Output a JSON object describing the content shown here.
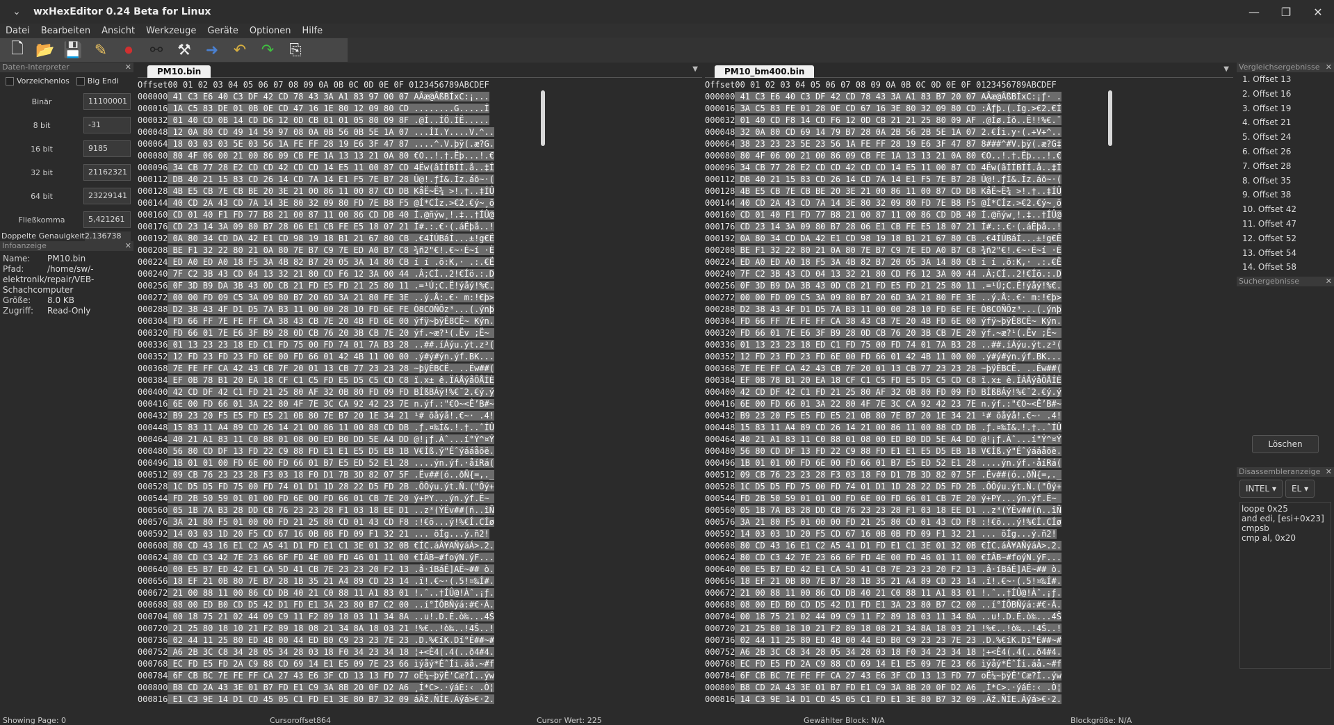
{
  "window": {
    "title": "wxHexEditor 0.24 Beta for Linux"
  },
  "menu": [
    "Datei",
    "Bearbeiten",
    "Ansicht",
    "Werkzeuge",
    "Geräte",
    "Optionen",
    "Hilfe"
  ],
  "data_interpreter": {
    "title": "Daten-Interpreter",
    "signed_label": "Vorzeichenlos",
    "big_endian_label": "Big Endi",
    "rows": [
      {
        "label": "Binär",
        "value": "11100001"
      },
      {
        "label": "8 bit",
        "value": "-31"
      },
      {
        "label": "16 bit",
        "value": "9185"
      },
      {
        "label": "32 bit",
        "value": "21162321"
      },
      {
        "label": "64 bit",
        "value": "23229141"
      },
      {
        "label": "Fließkomma",
        "value": "5,421261"
      }
    ],
    "double_label": "Doppelte Genauigkeit",
    "double_value": "2.136738"
  },
  "info": {
    "title": "Infoanzeige",
    "name_k": "Name:",
    "name_v": "PM10.bin",
    "path_k": "Pfad:",
    "path_v": "/home/sw/-",
    "path_v2": "elektronik/repair/VEB-",
    "path_v3": "Schachcomputer",
    "size_k": "Größe:",
    "size_v": "8.0 KB",
    "access_k": "Zugriff:",
    "access_v": "Read-Only"
  },
  "header_line": "Offset00 01 02 03 04 05 06 07 08 09 0A 0B 0C 0D 0E 0F 0123456789ABCDEF",
  "left_editor": {
    "tab": "PM10.bin",
    "lines": [
      [
        "000000",
        "41 C3 E6 40 C3 DF 42 CD 78 43 3A A1 83 97 00 07",
        "AÃæ@ÃßBÍxC:¡..."
      ],
      [
        "000016",
        "1A C5 83 DE 01 0B 0E CD 47 16 1E 80 12 09 80 CD",
        "........G.....Í"
      ],
      [
        "000032",
        "01 40 CD 0B 14 CD D6 12 0D CB 01 01 05 80 09 8F",
        ".@Í..ÍÖ.ÍË....."
      ],
      [
        "000048",
        "12 0A 80 CD 49 14 59 97 08 0A 0B 56 0B 5E 1A 07",
        "...ÍI.Y....V.^.."
      ],
      [
        "000064",
        "18 03 03 03 5E 03 56 1A FE FF 28 19 E6 3F 47 87",
        "....^.V.þÿ(.æ?G."
      ],
      [
        "000080",
        "80 4F 06 00 21 00 86 09 CB FE 1A 13 13 21 0A 80",
        "€O..!.†.Ëþ...!.€"
      ],
      [
        "000096",
        "34 CB 77 28 E2 CD CD 42 CD CD 14 E5 11 00 87 CD",
        "4Ëw(âÍÍBÍÍ.å..‡Í"
      ],
      [
        "000112",
        "DB 40 21 15 83 CD 26 14 CD 7A 14 E1 F5 7E B7 28",
        "Û@!.ƒÍ&.Íz.áõ~·("
      ],
      [
        "000128",
        "4B E5 CB 7E CB BE 20 3E 21 00 86 11 00 87 CD DB",
        "KåË~Ë¾ >!.†..‡ÍÛ"
      ],
      [
        "000144",
        "40 CD 2A 43 CD 7A 14 3E 80 32 09 80 FD 7E B8 F5",
        "@Í*CÍz.>€2.€ý~¸õ"
      ],
      [
        "000160",
        "CD 01 40 F1 FD 77 B8 21 00 87 11 00 86 CD DB 40",
        "Í.@ñýw¸!.‡..†ÍÛ@"
      ],
      [
        "000176",
        "CD 23 14 3A 09 80 B7 28 06 E1 CB FE E5 18 07 21",
        "Í#.:.€·(.áËþå..!"
      ],
      [
        "000192",
        "0A 80 34 CD DA 42 E1 CD 98 19 18 B1 21 67 80 CB",
        ".€4ÍÚBáÍ...±!g€Ë"
      ],
      [
        "000208",
        "BE F1 32 22 80 21 0A 80 7E B7 C9 7E ED A0 B7 C8",
        "¾ñ2\"€!.€~·É~í ·È"
      ],
      [
        "000224",
        "ED A0 ED A0 18 F5 3A 4B 82 B7 20 05 3A 14 80 CB",
        "í í .õ:K‚· .:.€Ë"
      ],
      [
        "000240",
        "7F C2 3B 43 CD 04 13 32 21 80 CD F6 12 3A 00 44",
        ".Â;CÍ..2!€Íö.:.D"
      ],
      [
        "000256",
        "0F 3D B9 DA 3B 43 0D CB 21 FD E5 FD 21 25 80 11",
        ".=¹Ú;C.Ë!ýåý!%€."
      ],
      [
        "000272",
        "00 00 FD 09 C5 3A 09 80 B7 20 6D 3A 21 80 FE 3E",
        "..ý.Å:.€· m:!€þ>"
      ],
      [
        "000288",
        "D2 38 43 4F D1 D5 7A B3 11 00 00 28 10 FD 6E FE",
        "Ò8COÑÕz³...(.ýnþ"
      ],
      [
        "000304",
        "FD 66 FF 7E FE FF CA 38 43 CB 7E 20 4B FD 6E 00",
        "ýfÿ~þÿÊ8CË~ Kýn."
      ],
      [
        "000320",
        "FD 66 01 7E E6 3F B9 28 0D CB 76 20 3B CB 7E 20",
        "ýf.~æ?¹(.Ëv ;Ë~ "
      ],
      [
        "000336",
        "01 13 23 23 18 ED C1 FD 75 00 FD 74 01 7A B3 28",
        "..##.íÁýu.ýt.z³("
      ],
      [
        "000352",
        "12 FD 23 FD 23 FD 6E 00 FD 66 01 42 4B 11 00 00",
        ".ý#ý#ýn.ýf.BK..."
      ],
      [
        "000368",
        "7E FE FF CA 42 43 CB 7F 20 01 13 CB 77 23 23 28",
        "~þÿÊBCË. ..Ëw##("
      ],
      [
        "000384",
        "EF 0B 78 B1 20 EA 18 CF C1 C5 FD E5 D5 C5 CD C8",
        "ï.x± ê.ÏÁÅýåÕÅÍÈ"
      ],
      [
        "000400",
        "42 CD DF 42 C1 FD 21 25 80 AF 32 0B 80 FD 09 FD",
        "BÍßBÁý!%€¯2.€ý.ý"
      ],
      [
        "000416",
        "6E 00 FD 66 01 3A 22 80 4F 7E 3C CA 92 42 23 7E",
        "n.ýf.:\"€O~<Ê’B#~"
      ],
      [
        "000432",
        "B9 23 20 F5 E5 FD E5 21 0B 80 7E B7 20 1E 34 21",
        "¹# õåýå!.€~· .4!"
      ],
      [
        "000448",
        "15 83 11 A4 89 CD 26 14 21 00 86 11 00 88 CD DB",
        ".ƒ.¤‰Í&.!.†..ˆÍÛ"
      ],
      [
        "000464",
        "40 21 A1 83 11 C0 88 01 08 00 ED B0 DD 5E A4 DD",
        "@!¡ƒ.Àˆ...í°Ý^¤Ý"
      ],
      [
        "000480",
        "56 80 CD DF 13 FD 22 C9 88 FD E1 E1 E5 D5 EB 1B",
        "V€Íß.ý\"Éˆýááåõë."
      ],
      [
        "000496",
        "1B 01 01 00 FD 6E 00 FD 66 01 B7 E5 ED 52 E1 28",
        "....ýn.ýf.·åíRá("
      ],
      [
        "000512",
        "09 CB 76 23 23 28 F3 03 18 F0 D1 7B 3D 82 07 5F",
        ".Ëv##(ó..ðÑ{=‚._"
      ],
      [
        "000528",
        "1C D5 D5 FD 75 00 FD 74 01 D1 1D 28 22 D5 FD 2B",
        ".ÕÕýu.ýt.Ñ.(\"Õý+"
      ],
      [
        "000544",
        "FD 2B 50 59 01 01 00 FD 6E 00 FD 66 01 CB 7E 20",
        "ý+PY...ýn.ýf.Ë~ "
      ],
      [
        "000560",
        "05 1B 7A B3 28 DD CB 76 23 23 28 F1 03 18 EE D1",
        "..z³(ÝËv##(ñ..îÑ"
      ],
      [
        "000576",
        "3A 21 80 F5 01 00 00 FD 21 25 80 CD 01 43 CD F8",
        ":!€õ...ý!%€Í.CÍø"
      ],
      [
        "000592",
        "14 03 03 1D 20 F5 CD 67 16 0B 0B FD 09 F1 32 21",
        "... õÍg...ý.ñ2!"
      ],
      [
        "000608",
        "80 CD 43 16 E1 C2 A5 41 D1 FD E1 C1 3E 01 32 0B",
        "€ÍC.áÂ¥AÑýáÁ>.2."
      ],
      [
        "000624",
        "80 CD C3 42 7E 23 66 6F FD 4E 00 FD 46 01 11 00",
        "€ÍÃB~#foýN.ýF..."
      ],
      [
        "000640",
        "00 E5 B7 ED 42 E1 CA 5D 41 CB 7E 23 23 20 F2 13",
        ".å·íBáÊ]AË~## ò."
      ],
      [
        "000656",
        "18 EF 21 0B 80 7E B7 28 1B 35 21 A4 89 CD 23 14",
        ".ï!.€~·(.5!¤‰Í#."
      ],
      [
        "000672",
        "21 00 88 11 00 86 CD DB 40 21 C0 88 11 A1 83 01",
        "!.ˆ..†ÍÛ@!Àˆ.¡ƒ."
      ],
      [
        "000688",
        "08 00 ED B0 CD D5 42 D1 FD E1 3A 23 80 B7 C2 00",
        "..í°ÍÕBÑýá:#€·Â."
      ],
      [
        "000704",
        "00 18 75 21 02 44 09 C9 11 F2 89 18 03 11 34 8A",
        "..u!.D.É.ò‰...4Š"
      ],
      [
        "000720",
        "21 25 80 18 10 21 F2 89 18 08 21 34 8A 18 03 21",
        "!%€..!ò‰..!4Š..!"
      ],
      [
        "000736",
        "02 44 11 25 80 ED 4B 00 44 ED B0 C9 23 23 7E 23",
        ".D.%€íK.Dí°É##~#"
      ],
      [
        "000752",
        "A6 2B 3C C8 34 28 05 34 28 03 18 F0 34 23 34 18",
        "¦+<È4(.4(..ð4#4."
      ],
      [
        "000768",
        "EC FD E5 FD 2A C9 88 CD 69 14 E1 E5 09 7E 23 66",
        "ìýåý*ÉˆÍi.áå.~#f"
      ],
      [
        "000784",
        "6F CB BC 7E FE FF CA 27 43 E6 3F CD 13 13 FD 77",
        "oË¼~þÿÊ'Cæ?Í..ýw"
      ],
      [
        "000800",
        "B8 CD 2A 43 3E 01 B7 FD E1 C9 3A 8B 20 0F D2 A6",
        "¸Í*C>.·ýáÉ:‹ .Ò¦"
      ],
      [
        "000816",
        "E1 C3 9E 14 D1 CD 45 05 C1 FD E1 3E 80 B7 32 09",
        "áÃž.ÑÍE.Áýá>€·2."
      ]
    ]
  },
  "right_editor": {
    "tab": "PM10_bm400.bin",
    "lines": [
      [
        "000000",
        "41 C3 E6 40 C3 DF 42 CD 78 43 3A A1 83 B7 20 07",
        "AÃæ@ÃßBÍxC:¡ƒ· ."
      ],
      [
        "000016",
        "3A C5 83 FE 01 28 0E CD 67 16 3E 80 32 09 80 CD",
        ":Åƒþ.(.Íg.>€2.€Í"
      ],
      [
        "000032",
        "01 40 CD F8 14 CD F6 12 0D CB 21 21 25 80 09 AF",
        ".@Íø.Íö..Ë!!%€.¯"
      ],
      [
        "000048",
        "32 0A 80 CD 69 14 79 B7 28 0A 2B 56 2B 5E 1A 07",
        "2.€Íi.y·(.+V+^.."
      ],
      [
        "000064",
        "38 23 23 23 5E 23 56 1A FE FF 28 19 E6 3F 47 87",
        "8###^#V.þÿ(.æ?G‡"
      ],
      [
        "000080",
        "80 4F 06 00 21 00 86 09 CB FE 1A 13 13 21 0A 80",
        "€O..!.†.Ëþ...!.€"
      ],
      [
        "000096",
        "34 CB 77 28 E2 CD CD 42 CD CD 14 E5 11 00 87 CD",
        "4Ëw(âÍÍBÍÍ.å..‡Í"
      ],
      [
        "000112",
        "DB 40 21 15 83 CD 26 14 CD 7A 14 E1 F5 7E B7 28",
        "Û@!.ƒÍ&.Íz.áõ~·("
      ],
      [
        "000128",
        "4B E5 CB 7E CB BE 20 3E 21 00 86 11 00 87 CD DB",
        "KåË~Ë¾ >!.†..‡ÍÛ"
      ],
      [
        "000144",
        "40 CD 2A 43 CD 7A 14 3E 80 32 09 80 FD 7E B8 F5",
        "@Í*CÍz.>€2.€ý~¸õ"
      ],
      [
        "000160",
        "CD 01 40 F1 FD 77 B8 21 00 87 11 00 86 CD DB 40",
        "Í.@ñýw¸!.‡..†ÍÛ@"
      ],
      [
        "000176",
        "CD 23 14 3A 09 80 B7 28 06 E1 CB FE E5 18 07 21",
        "Í#.:.€·(.áËþå..!"
      ],
      [
        "000192",
        "0A 80 34 CD DA 42 E1 CD 98 19 18 B1 21 67 80 CB",
        ".€4ÍÚBáÍ...±!g€Ë"
      ],
      [
        "000208",
        "BE F1 32 22 80 21 0A 80 7E B7 C9 7E ED A0 B7 C8",
        "¾ñ2\"€!.€~·É~í ·È"
      ],
      [
        "000224",
        "ED A0 ED A0 18 F5 3A 4B 82 B7 20 05 3A 14 80 CB",
        "í í .õ:K‚· .:.€Ë"
      ],
      [
        "000240",
        "7F C2 3B 43 CD 04 13 32 21 80 CD F6 12 3A 00 44",
        ".Â;CÍ..2!€Íö.:.D"
      ],
      [
        "000256",
        "0F 3D B9 DA 3B 43 0D CB 21 FD E5 FD 21 25 80 11",
        ".=¹Ú;C.Ë!ýåý!%€."
      ],
      [
        "000272",
        "00 00 FD 09 C5 3A 09 80 B7 20 6D 3A 21 80 FE 3E",
        "..ý.Å:.€· m:!€þ>"
      ],
      [
        "000288",
        "D2 38 43 4F D1 D5 7A B3 11 00 00 28 10 FD 6E FE",
        "Ò8COÑÕz³...(.ýnþ"
      ],
      [
        "000304",
        "FD 66 FF 7E FE FF CA 38 43 CB 7E 20 4B FD 6E 00",
        "ýfÿ~þÿÊ8CË~ Kýn."
      ],
      [
        "000320",
        "FD 66 01 7E E6 3F B9 28 0D CB 76 20 3B CB 7E 20",
        "ýf.~æ?¹(.Ëv ;Ë~ "
      ],
      [
        "000336",
        "01 13 23 23 18 ED C1 FD 75 00 FD 74 01 7A B3 28",
        "..##.íÁýu.ýt.z³("
      ],
      [
        "000352",
        "12 FD 23 FD 23 FD 6E 00 FD 66 01 42 4B 11 00 00",
        ".ý#ý#ýn.ýf.BK..."
      ],
      [
        "000368",
        "7E FE FF CA 42 43 CB 7F 20 01 13 CB 77 23 23 28",
        "~þÿÊBCË. ..Ëw##("
      ],
      [
        "000384",
        "EF 0B 78 B1 20 EA 18 CF C1 C5 FD E5 D5 C5 CD C8",
        "ï.x± ê.ÏÁÅýåÕÅÍÈ"
      ],
      [
        "000400",
        "42 CD DF 42 C1 FD 21 25 80 AF 32 0B 80 FD 09 FD",
        "BÍßBÁý!%€¯2.€ý.ý"
      ],
      [
        "000416",
        "6E 00 FD 66 01 3A 22 80 4F 7E 3C CA 92 42 23 7E",
        "n.ýf.:\"€O~<Ê’B#~"
      ],
      [
        "000432",
        "B9 23 20 F5 E5 FD E5 21 0B 80 7E B7 20 1E 34 21",
        "¹# õåýå!.€~· .4!"
      ],
      [
        "000448",
        "15 83 11 A4 89 CD 26 14 21 00 86 11 00 88 CD DB",
        ".ƒ.¤‰Í&.!.†..ˆÍÛ"
      ],
      [
        "000464",
        "40 21 A1 83 11 C0 88 01 08 00 ED B0 DD 5E A4 DD",
        "@!¡ƒ.Àˆ...í°Ý^¤Ý"
      ],
      [
        "000480",
        "56 80 CD DF 13 FD 22 C9 88 FD E1 E1 E5 D5 EB 1B",
        "V€Íß.ý\"Éˆýááåõë."
      ],
      [
        "000496",
        "1B 01 01 00 FD 6E 00 FD 66 01 B7 E5 ED 52 E1 28",
        "....ýn.ýf.·åíRá("
      ],
      [
        "000512",
        "09 CB 76 23 23 28 F3 03 18 F0 D1 7B 3D 82 07 5F",
        ".Ëv##(ó..ðÑ{=‚._"
      ],
      [
        "000528",
        "1C D5 D5 FD 75 00 FD 74 01 D1 1D 28 22 D5 FD 2B",
        ".ÕÕýu.ýt.Ñ.(\"Õý+"
      ],
      [
        "000544",
        "FD 2B 50 59 01 01 00 FD 6E 00 FD 66 01 CB 7E 20",
        "ý+PY...ýn.ýf.Ë~ "
      ],
      [
        "000560",
        "05 1B 7A B3 28 DD CB 76 23 23 28 F1 03 18 EE D1",
        "..z³(ÝËv##(ñ..îÑ"
      ],
      [
        "000576",
        "3A 21 80 F5 01 00 00 FD 21 25 80 CD 01 43 CD F8",
        ":!€õ...ý!%€Í.CÍø"
      ],
      [
        "000592",
        "14 03 03 1D 20 F5 CD 67 16 0B 0B FD 09 F1 32 21",
        "... õÍg...ý.ñ2!"
      ],
      [
        "000608",
        "80 CD 43 16 E1 C2 A5 41 D1 FD E1 C1 3E 01 32 0B",
        "€ÍC.áÂ¥AÑýáÁ>.2."
      ],
      [
        "000624",
        "80 CD C3 42 7E 23 66 6F FD 4E 00 FD 46 01 11 00",
        "€ÍÃB~#foýN.ýF..."
      ],
      [
        "000640",
        "00 E5 B7 ED 42 E1 CA 5D 41 CB 7E 23 23 20 F2 13",
        ".å·íBáÊ]AË~## ò."
      ],
      [
        "000656",
        "18 EF 21 0B 80 7E B7 28 1B 35 21 A4 89 CD 23 14",
        ".ï!.€~·(.5!¤‰Í#."
      ],
      [
        "000672",
        "21 00 88 11 00 86 CD DB 40 21 C0 88 11 A1 83 01",
        "!.ˆ..†ÍÛ@!Àˆ.¡ƒ."
      ],
      [
        "000688",
        "08 00 ED B0 CD D5 42 D1 FD E1 3A 23 80 B7 C2 00",
        "..í°ÍÕBÑýá:#€·Â."
      ],
      [
        "000704",
        "00 18 75 21 02 44 09 C9 11 F2 89 18 03 11 34 8A",
        "..u!.D.É.ò‰...4Š"
      ],
      [
        "000720",
        "21 25 80 18 10 21 F2 89 18 08 21 34 8A 18 03 21",
        "!%€..!ò‰..!4Š..!"
      ],
      [
        "000736",
        "02 44 11 25 80 ED 4B 00 44 ED B0 C9 23 23 7E 23",
        ".D.%€íK.Dí°É##~#"
      ],
      [
        "000752",
        "A6 2B 3C C8 34 28 05 34 28 03 18 F0 34 23 34 18",
        "¦+<È4(.4(..ð4#4."
      ],
      [
        "000768",
        "EC FD E5 FD 2A C9 88 CD 69 14 E1 E5 09 7E 23 66",
        "ìýåý*ÉˆÍi.áå.~#f"
      ],
      [
        "000784",
        "6F CB BC 7E FE FF CA 27 43 E6 3F CD 13 13 FD 77",
        "oË¼~þÿÊ'Cæ?Í..ýw"
      ],
      [
        "000800",
        "B8 CD 2A 43 3E 01 B7 FD E1 C9 3A 8B 20 0F D2 A6",
        "¸Í*C>.·ýáÉ:‹ .Ò¦"
      ],
      [
        "000816",
        "14 C3 9E 14 D1 CD 45 05 C1 FD E1 3E 80 B7 32 09",
        ".Ãž.ÑÍE.Áýá>€·2."
      ]
    ]
  },
  "compare": {
    "title": "Vergleichsergebnisse",
    "items": [
      "1. Offset 13",
      "2. Offset 16",
      "3. Offset 19",
      "4. Offset 21",
      "5. Offset 24",
      "6. Offset 26",
      "7. Offset 28",
      "8. Offset 35",
      "9. Offset 38",
      "10. Offset 42",
      "11. Offset 47",
      "12. Offset 52",
      "13. Offset 54",
      "14. Offset 58"
    ]
  },
  "search": {
    "title": "Suchergebnisse",
    "clear": "Löschen"
  },
  "disasm": {
    "title": "Disassembleranzeige",
    "arch": "INTEL",
    "mode": "EL",
    "lines": [
      "loope 0x25",
      "and edi, [esi+0x23]",
      "cmpsb",
      "cmp al, 0x20"
    ]
  },
  "status": {
    "page": "Showing Page: 0",
    "cursor_offset": "Cursoroffset864",
    "cursor_value": "Cursor Wert: 225",
    "selected_block": "Gewählter Block: N/A",
    "block_size": "Blockgröße: N/A"
  },
  "colors": {
    "diff": "#f07070",
    "hexbg": "#6c6c6c",
    "bg": "#2b2b2b"
  }
}
